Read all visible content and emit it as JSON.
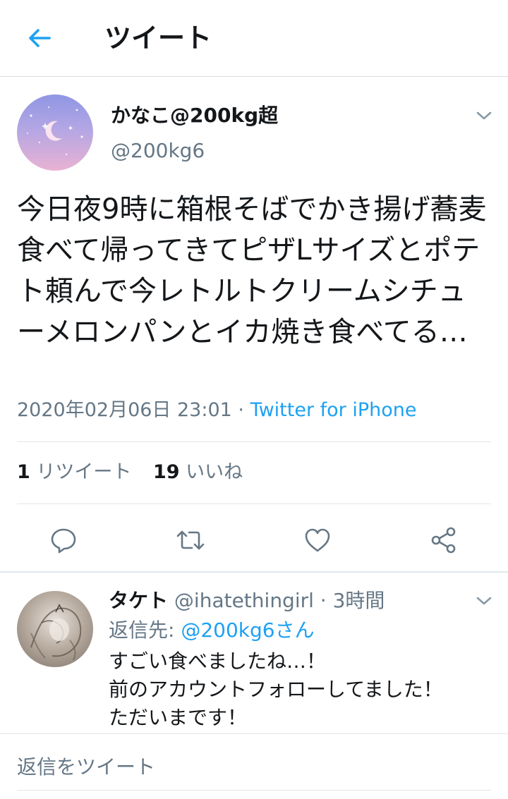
{
  "header": {
    "title": "ツイート",
    "back_icon": "arrow-left-icon"
  },
  "tweet": {
    "author_name": "かなこ@200kg超",
    "author_handle": "@200kg6",
    "text": "今日夜9時に箱根そばでかき揚げ蕎麦食べて帰ってきてピザLサイズとポテト頼んで今レトルトクリームシチューメロンパンとイカ焼き食べてる…",
    "timestamp": "2020年02月06日 23:01",
    "separator": " · ",
    "source": "Twitter for iPhone",
    "retweet_count": "1",
    "retweet_label": "リツイート",
    "like_count": "19",
    "like_label": "いいね"
  },
  "reply": {
    "name": "タケト",
    "handle": "@ihatethingirl",
    "time": " · 3時間",
    "replying_to_label": "返信先: ",
    "replying_to": "@200kg6さん",
    "lines": [
      "すごい食べましたね…！",
      "前のアカウントフォローしてました！",
      "ただいまです！"
    ]
  },
  "compose": {
    "placeholder": "返信をツイート"
  },
  "colors": {
    "accent": "#1da1f2",
    "secondary_text": "#657786",
    "primary_text": "#14171a",
    "divider": "#e1e8ed"
  }
}
